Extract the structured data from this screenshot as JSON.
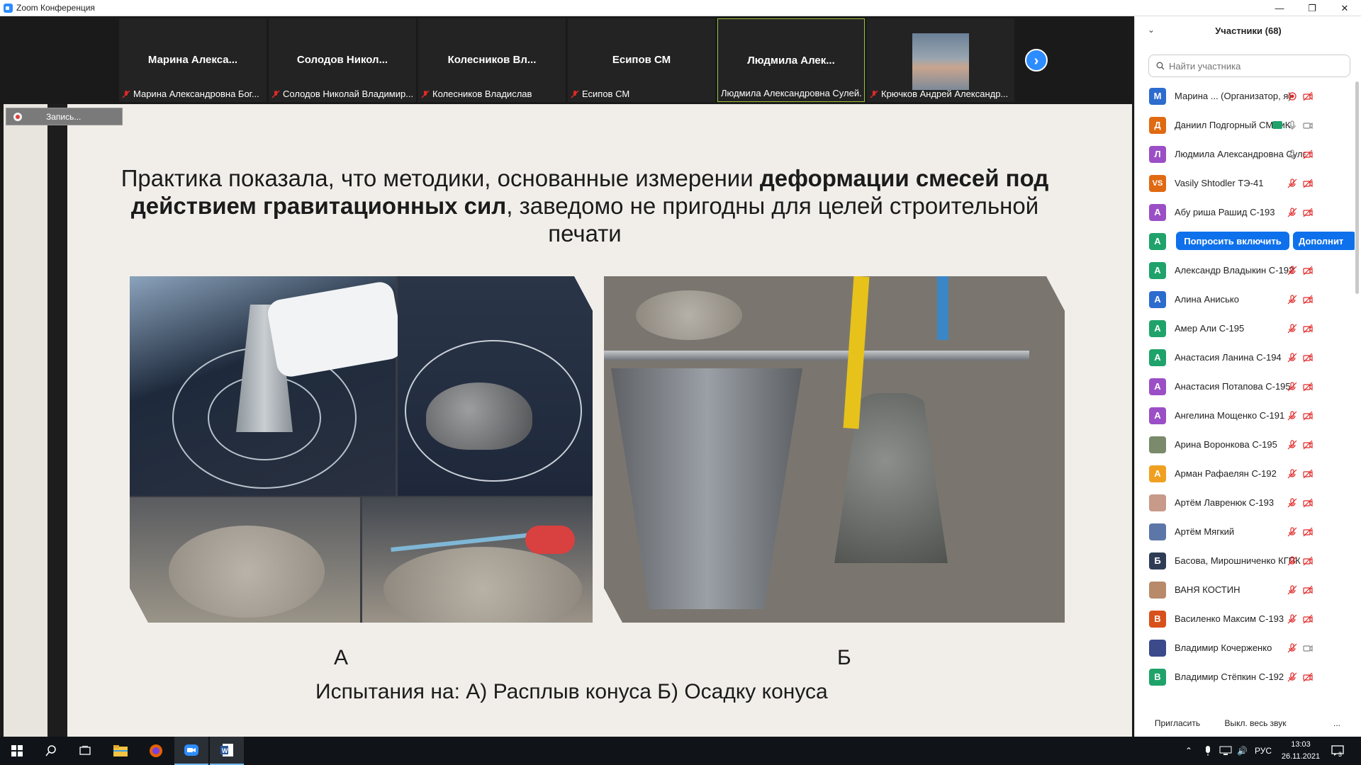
{
  "window": {
    "title": "Zoom Конференция",
    "controls": [
      "minimize",
      "maximize",
      "close"
    ]
  },
  "video_strip": {
    "tiles": [
      {
        "name": "Марина  Алекса...",
        "label": "Марина Александровна Бог..."
      },
      {
        "name": "Солодов  Никол...",
        "label": "Солодов Николай Владимир..."
      },
      {
        "name": "Колесников  Вл...",
        "label": "Колесников Владислав"
      },
      {
        "name": "Есипов СМ",
        "label": "Есипов СМ"
      },
      {
        "name": "Людмила  Алек...",
        "label": "Людмила Александровна Сулей..."
      },
      {
        "name": "",
        "label": "Крючков Андрей Александр..."
      }
    ]
  },
  "recording": {
    "label": "Запись..."
  },
  "slide": {
    "title_part1": "Практика показала, что методики, основанные измерении ",
    "title_bold1": "деформации смесей под действием гравитационных сил",
    "title_part2": ", заведомо не пригодны для целей строительной печати",
    "label_a": "А",
    "label_b": "Б",
    "caption": "Испытания на: А) Расплыв конуса Б) Осадку конуса"
  },
  "participants": {
    "title": "Участники (68)",
    "search_placeholder": "Найти участника",
    "ask_button": "Попросить включить",
    "more_button": "Дополнит",
    "invite_button": "Пригласить",
    "mute_all_button": "Выкл. весь звук",
    "more_options": "...",
    "items": [
      {
        "initials": "М",
        "color": "#2d6ccf",
        "name": "Марина ...   (Организатор, я)",
        "mic": "recording",
        "video": "off"
      },
      {
        "initials": "Д",
        "color": "#e06a12",
        "name": "Даниил Подгорный СМИиК",
        "mic": "on",
        "video": "on",
        "badge": "share"
      },
      {
        "initials": "Л",
        "color": "#9b4fc6",
        "name": "Людмила Александровна Суле...",
        "mic": "on",
        "video": "off"
      },
      {
        "initials": "VS",
        "color": "#e06a12",
        "name": "Vasily Shtodler ТЭ-41",
        "mic": "off",
        "video": "off"
      },
      {
        "initials": "А",
        "color": "#9b4fc6",
        "name": "Абу риша Рашид С-193",
        "mic": "off",
        "video": "off"
      },
      {
        "initials": "А",
        "color": "#1fa36a",
        "name": "",
        "hover": true
      },
      {
        "initials": "А",
        "color": "#1fa36a",
        "name": "Александр Владыкин С-192",
        "mic": "off",
        "video": "off"
      },
      {
        "initials": "А",
        "color": "#2d6ccf",
        "name": "Алина Анисько",
        "mic": "off",
        "video": "off"
      },
      {
        "initials": "А",
        "color": "#1fa36a",
        "name": "Амер Али С-195",
        "mic": "off",
        "video": "off"
      },
      {
        "initials": "А",
        "color": "#1fa36a",
        "name": "Анастасия Ланина С-194",
        "mic": "off",
        "video": "off"
      },
      {
        "initials": "А",
        "color": "#9b4fc6",
        "name": "Анастасия Потапова С-195",
        "mic": "off",
        "video": "off"
      },
      {
        "initials": "А",
        "color": "#9b4fc6",
        "name": "Ангелина Мощенко С-191",
        "mic": "off",
        "video": "off"
      },
      {
        "initials": "",
        "color": "#7a8a6a",
        "name": "Арина Воронкова С-195",
        "mic": "off",
        "video": "off",
        "photo": true
      },
      {
        "initials": "А",
        "color": "#f0a020",
        "name": "Арман Рафаелян С-192",
        "mic": "off",
        "video": "off"
      },
      {
        "initials": "",
        "color": "#c79a8a",
        "name": "Артём Лавренюк С-193",
        "mic": "off",
        "video": "off",
        "photo": true
      },
      {
        "initials": "",
        "color": "#5d76a8",
        "name": "Артём Мягкий",
        "mic": "off",
        "video": "off",
        "photo": true
      },
      {
        "initials": "Б",
        "color": "#2e3d55",
        "name": "Басова, Мирошниченко КГПК",
        "mic": "off",
        "video": "off"
      },
      {
        "initials": "",
        "color": "#b88a6a",
        "name": "ВАНЯ КОСТИН",
        "mic": "off",
        "video": "off",
        "photo": true
      },
      {
        "initials": "В",
        "color": "#d8511a",
        "name": "Василенко Максим С-193",
        "mic": "off",
        "video": "off"
      },
      {
        "initials": "",
        "color": "#3a4a8a",
        "name": "Владимир Кочерженко",
        "mic": "off",
        "video": "on",
        "photo": true
      },
      {
        "initials": "В",
        "color": "#1fa36a",
        "name": "Владимир Стёпкин С-192",
        "mic": "off",
        "video": "off"
      }
    ]
  },
  "taskbar": {
    "language": "РУС",
    "time": "13:03",
    "date": "26.11.2021",
    "notifications": "3"
  },
  "colors": {
    "zoom_blue": "#2d8cff",
    "button_blue": "#0e71eb",
    "muted_red": "#e02828",
    "active_speaker": "#9fc43b"
  }
}
